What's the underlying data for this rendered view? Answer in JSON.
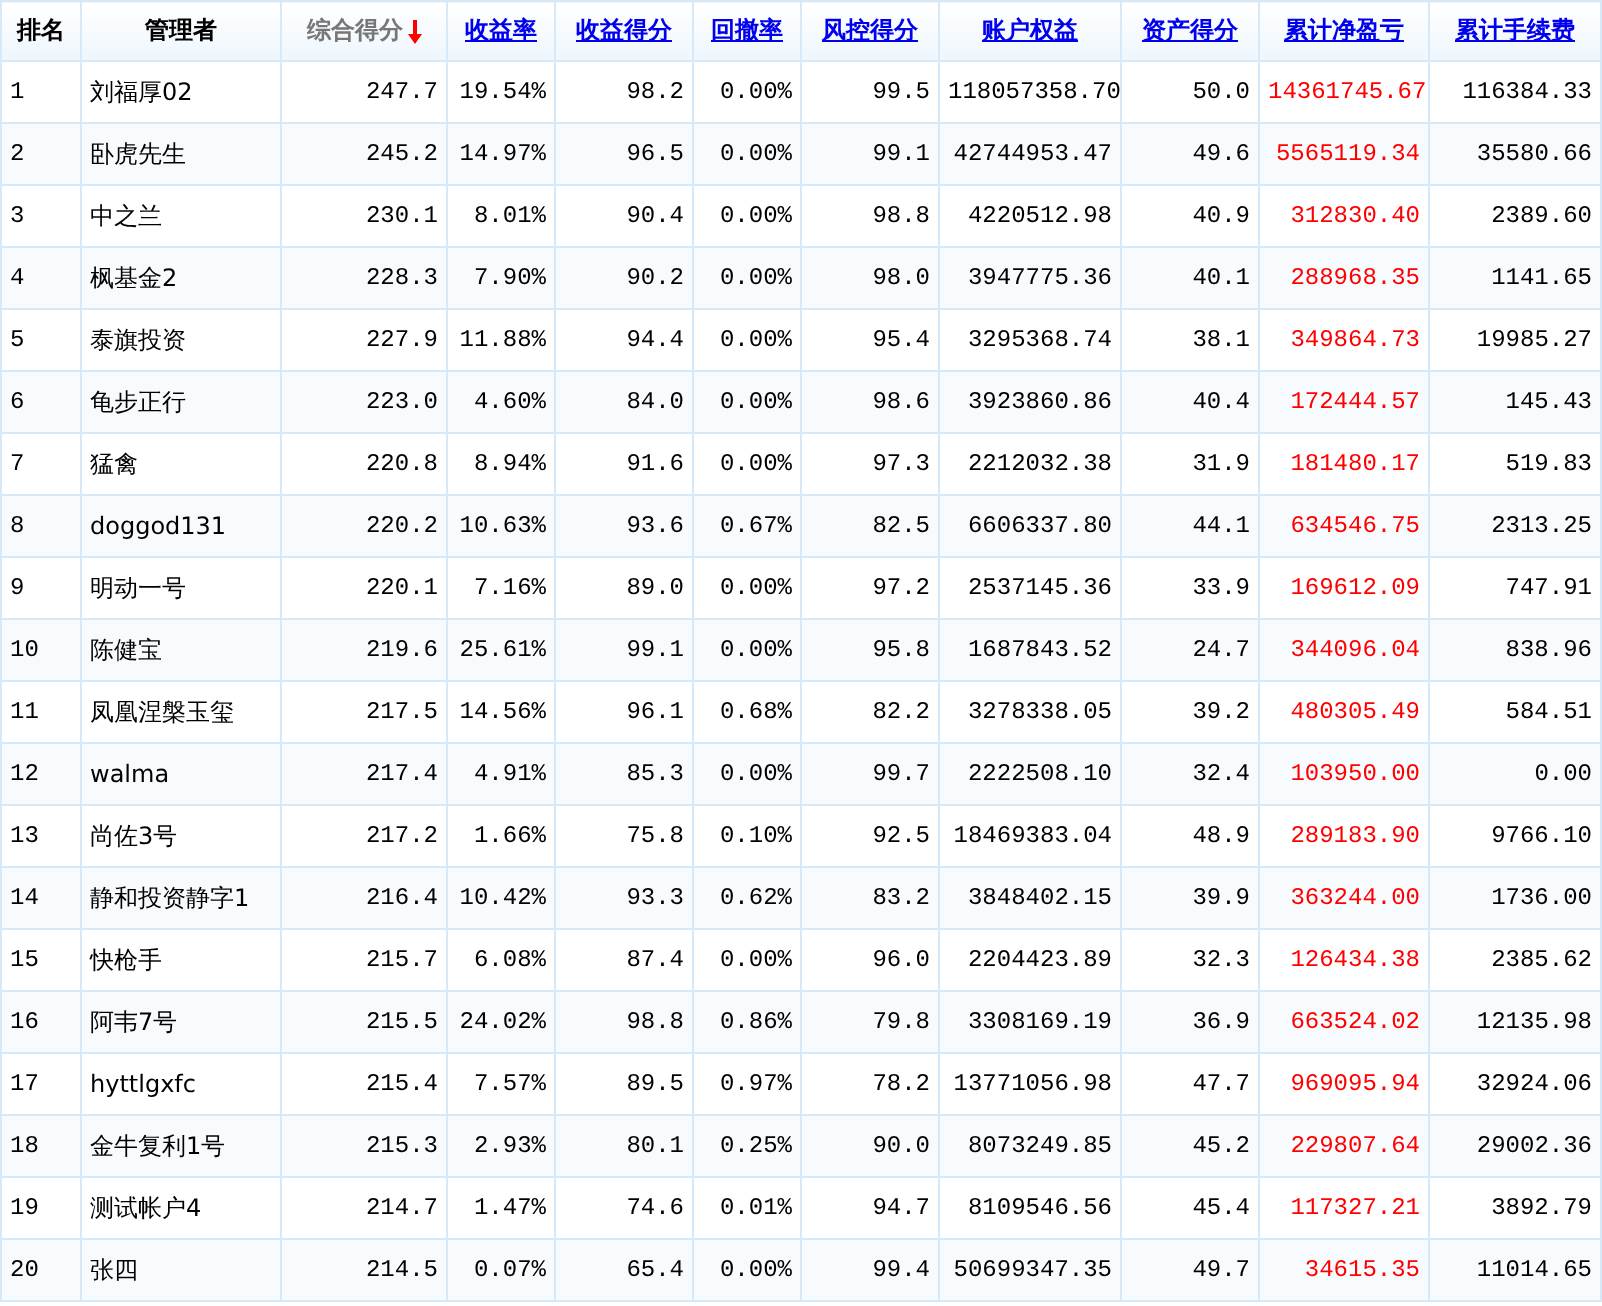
{
  "table": {
    "columns": [
      {
        "label": "排名",
        "kind": "plain",
        "highlight": false
      },
      {
        "label": "管理者",
        "kind": "plain",
        "highlight": false
      },
      {
        "label": "综合得分",
        "kind": "sorted",
        "highlight": false
      },
      {
        "label": "收益率",
        "kind": "link",
        "highlight": false
      },
      {
        "label": "收益得分",
        "kind": "link",
        "highlight": false
      },
      {
        "label": "回撤率",
        "kind": "link",
        "highlight": false
      },
      {
        "label": "风控得分",
        "kind": "link",
        "highlight": false
      },
      {
        "label": "账户权益",
        "kind": "link",
        "highlight": false
      },
      {
        "label": "资产得分",
        "kind": "link",
        "highlight": false
      },
      {
        "label": "累计净盈亏",
        "kind": "link",
        "highlight": true
      },
      {
        "label": "累计手续费",
        "kind": "link",
        "highlight": false
      }
    ],
    "rows": [
      [
        "1",
        "刘福厚02",
        "247.7",
        "19.54%",
        "98.2",
        "0.00%",
        "99.5",
        "118057358.70",
        "50.0",
        "14361745.67",
        "116384.33"
      ],
      [
        "2",
        "卧虎先生",
        "245.2",
        "14.97%",
        "96.5",
        "0.00%",
        "99.1",
        "42744953.47",
        "49.6",
        "5565119.34",
        "35580.66"
      ],
      [
        "3",
        "中之兰",
        "230.1",
        "8.01%",
        "90.4",
        "0.00%",
        "98.8",
        "4220512.98",
        "40.9",
        "312830.40",
        "2389.60"
      ],
      [
        "4",
        "枫基金2",
        "228.3",
        "7.90%",
        "90.2",
        "0.00%",
        "98.0",
        "3947775.36",
        "40.1",
        "288968.35",
        "1141.65"
      ],
      [
        "5",
        "泰旗投资",
        "227.9",
        "11.88%",
        "94.4",
        "0.00%",
        "95.4",
        "3295368.74",
        "38.1",
        "349864.73",
        "19985.27"
      ],
      [
        "6",
        "龟步正行",
        "223.0",
        "4.60%",
        "84.0",
        "0.00%",
        "98.6",
        "3923860.86",
        "40.4",
        "172444.57",
        "145.43"
      ],
      [
        "7",
        "猛禽",
        "220.8",
        "8.94%",
        "91.6",
        "0.00%",
        "97.3",
        "2212032.38",
        "31.9",
        "181480.17",
        "519.83"
      ],
      [
        "8",
        "doggod131",
        "220.2",
        "10.63%",
        "93.6",
        "0.67%",
        "82.5",
        "6606337.80",
        "44.1",
        "634546.75",
        "2313.25"
      ],
      [
        "9",
        "明动一号",
        "220.1",
        "7.16%",
        "89.0",
        "0.00%",
        "97.2",
        "2537145.36",
        "33.9",
        "169612.09",
        "747.91"
      ],
      [
        "10",
        "陈健宝",
        "219.6",
        "25.61%",
        "99.1",
        "0.00%",
        "95.8",
        "1687843.52",
        "24.7",
        "344096.04",
        "838.96"
      ],
      [
        "11",
        "凤凰涅槃玉玺",
        "217.5",
        "14.56%",
        "96.1",
        "0.68%",
        "82.2",
        "3278338.05",
        "39.2",
        "480305.49",
        "584.51"
      ],
      [
        "12",
        "walma",
        "217.4",
        "4.91%",
        "85.3",
        "0.00%",
        "99.7",
        "2222508.10",
        "32.4",
        "103950.00",
        "0.00"
      ],
      [
        "13",
        "尚佐3号",
        "217.2",
        "1.66%",
        "75.8",
        "0.10%",
        "92.5",
        "18469383.04",
        "48.9",
        "289183.90",
        "9766.10"
      ],
      [
        "14",
        "静和投资静字1",
        "216.4",
        "10.42%",
        "93.3",
        "0.62%",
        "83.2",
        "3848402.15",
        "39.9",
        "363244.00",
        "1736.00"
      ],
      [
        "15",
        "快枪手",
        "215.7",
        "6.08%",
        "87.4",
        "0.00%",
        "96.0",
        "2204423.89",
        "32.3",
        "126434.38",
        "2385.62"
      ],
      [
        "16",
        "阿韦7号",
        "215.5",
        "24.02%",
        "98.8",
        "0.86%",
        "79.8",
        "3308169.19",
        "36.9",
        "663524.02",
        "12135.98"
      ],
      [
        "17",
        "hyttlgxfc",
        "215.4",
        "7.57%",
        "89.5",
        "0.97%",
        "78.2",
        "13771056.98",
        "47.7",
        "969095.94",
        "32924.06"
      ],
      [
        "18",
        "金牛复利1号",
        "215.3",
        "2.93%",
        "80.1",
        "0.25%",
        "90.0",
        "8073249.85",
        "45.2",
        "229807.64",
        "29002.36"
      ],
      [
        "19",
        "测试帐户4",
        "214.7",
        "1.47%",
        "74.6",
        "0.01%",
        "94.7",
        "8109546.56",
        "45.4",
        "117327.21",
        "3892.79"
      ],
      [
        "20",
        "张四",
        "214.5",
        "0.07%",
        "65.4",
        "0.00%",
        "99.4",
        "50699347.35",
        "49.7",
        "34615.35",
        "11014.65"
      ]
    ]
  }
}
